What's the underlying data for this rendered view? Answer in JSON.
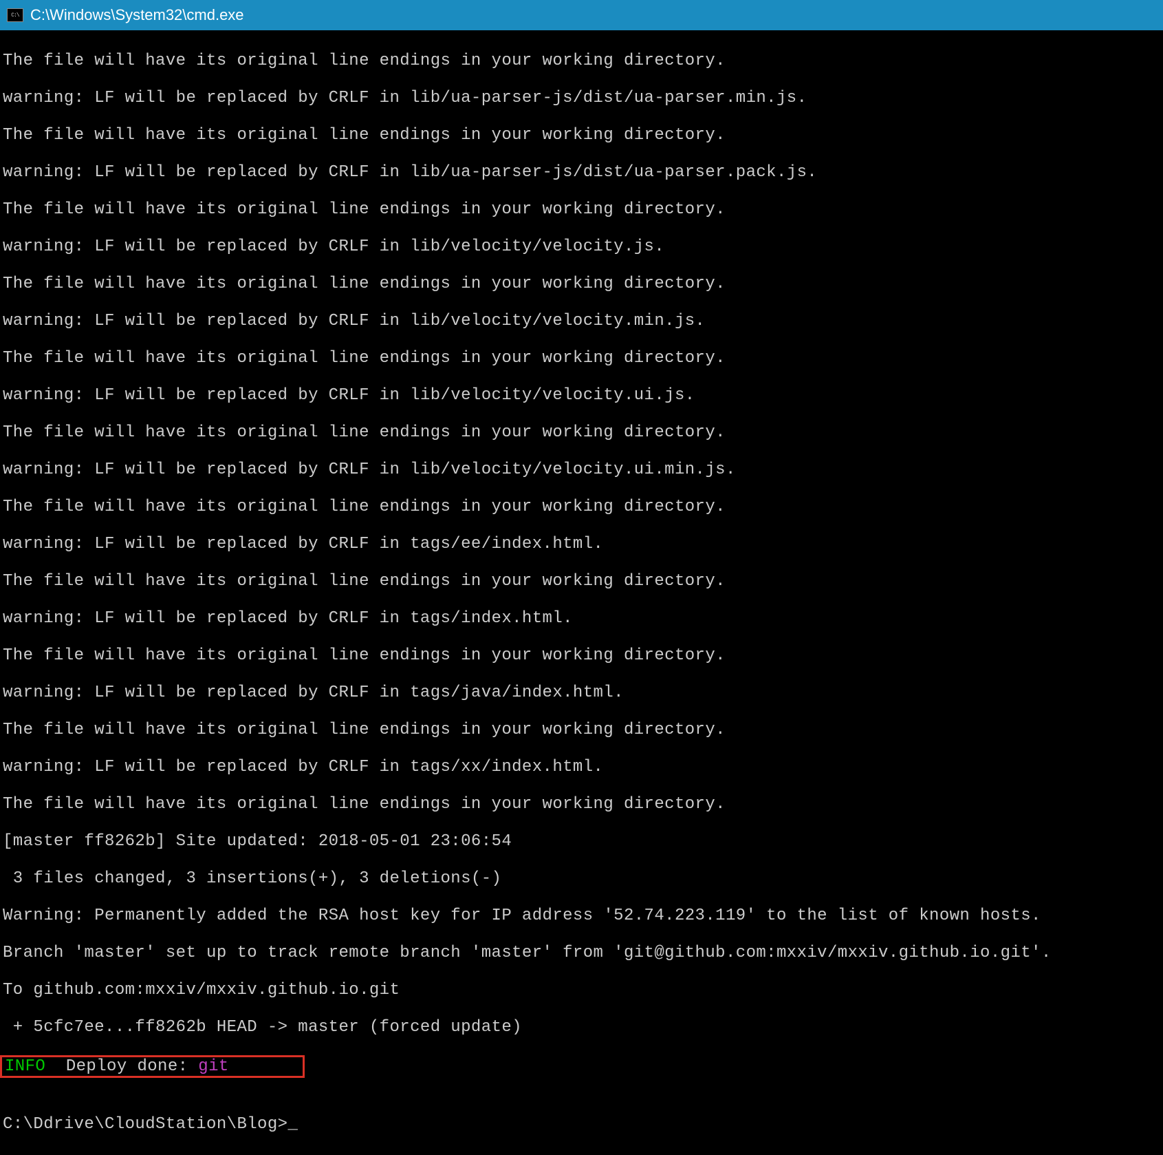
{
  "titlebar": {
    "icon_label": "C:\\",
    "title": "C:\\Windows\\System32\\cmd.exe"
  },
  "terminal": {
    "lines": [
      "The file will have its original line endings in your working directory.",
      "warning: LF will be replaced by CRLF in lib/ua-parser-js/dist/ua-parser.min.js.",
      "The file will have its original line endings in your working directory.",
      "warning: LF will be replaced by CRLF in lib/ua-parser-js/dist/ua-parser.pack.js.",
      "The file will have its original line endings in your working directory.",
      "warning: LF will be replaced by CRLF in lib/velocity/velocity.js.",
      "The file will have its original line endings in your working directory.",
      "warning: LF will be replaced by CRLF in lib/velocity/velocity.min.js.",
      "The file will have its original line endings in your working directory.",
      "warning: LF will be replaced by CRLF in lib/velocity/velocity.ui.js.",
      "The file will have its original line endings in your working directory.",
      "warning: LF will be replaced by CRLF in lib/velocity/velocity.ui.min.js.",
      "The file will have its original line endings in your working directory.",
      "warning: LF will be replaced by CRLF in tags/ee/index.html.",
      "The file will have its original line endings in your working directory.",
      "warning: LF will be replaced by CRLF in tags/index.html.",
      "The file will have its original line endings in your working directory.",
      "warning: LF will be replaced by CRLF in tags/java/index.html.",
      "The file will have its original line endings in your working directory.",
      "warning: LF will be replaced by CRLF in tags/xx/index.html.",
      "The file will have its original line endings in your working directory.",
      "[master ff8262b] Site updated: 2018-05-01 23:06:54",
      " 3 files changed, 3 insertions(+), 3 deletions(-)",
      "Warning: Permanently added the RSA host key for IP address '52.74.223.119' to the list of known hosts.",
      "Branch 'master' set up to track remote branch 'master' from 'git@github.com:mxxiv/mxxiv.github.io.git'.",
      "To github.com:mxxiv/mxxiv.github.io.git",
      " + 5cfc7ee...ff8262b HEAD -> master (forced update)"
    ],
    "deploy_line": {
      "info": "INFO",
      "middle": "  Deploy done: ",
      "git": "git"
    },
    "blank_line": "",
    "prompt": "C:\\Ddrive\\CloudStation\\Blog>"
  }
}
